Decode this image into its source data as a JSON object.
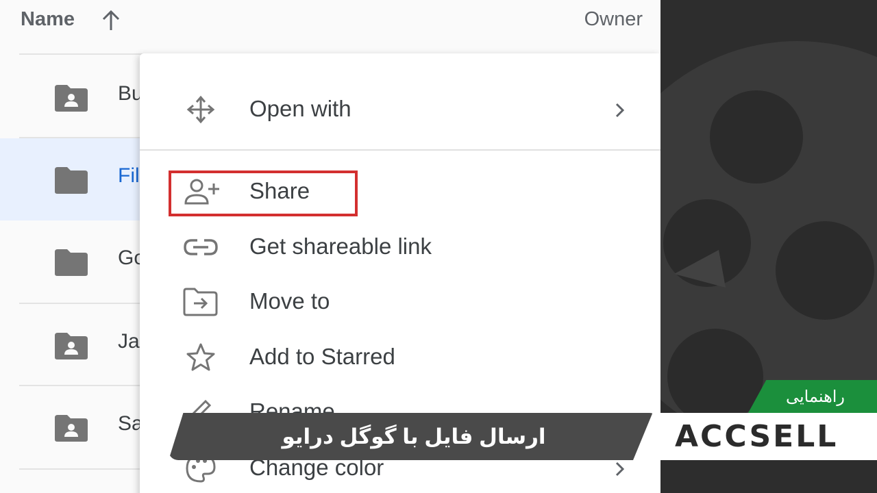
{
  "list": {
    "header": {
      "name_label": "Name",
      "owner_label": "Owner",
      "sort_icon": "arrow-up-icon"
    },
    "rows": [
      {
        "name": "Bu",
        "icon": "shared-folder-icon",
        "selected": false
      },
      {
        "name": "Fil",
        "icon": "folder-icon",
        "selected": true
      },
      {
        "name": "Go",
        "icon": "folder-icon",
        "selected": false
      },
      {
        "name": "Ja",
        "icon": "shared-folder-icon",
        "selected": false
      },
      {
        "name": "Sa",
        "icon": "shared-folder-icon",
        "selected": false
      }
    ]
  },
  "menu": {
    "items": [
      {
        "label": "Open with",
        "icon": "open-with-icon",
        "submenu": true
      },
      {
        "label": "Share",
        "icon": "person-add-icon",
        "submenu": false,
        "highlighted": true
      },
      {
        "label": "Get shareable link",
        "icon": "link-icon",
        "submenu": false
      },
      {
        "label": "Move to",
        "icon": "move-to-folder-icon",
        "submenu": false
      },
      {
        "label": "Add to Starred",
        "icon": "star-icon",
        "submenu": false
      },
      {
        "label": "Rename",
        "icon": "pencil-icon",
        "submenu": false
      },
      {
        "label": "Change color",
        "icon": "palette-icon",
        "submenu": true
      }
    ],
    "highlight_color": "#d32f2f"
  },
  "banner": {
    "title": "ارسال فایل با گوگل درایو",
    "tag": "راهنمایی",
    "logo_text": "ACCSELL",
    "tag_color": "#1b8f3c"
  },
  "colors": {
    "selected_row": "#e8f0fe",
    "selected_text": "#1967d2",
    "icon_gray": "#757575",
    "dark_panel": "#2d2d2d"
  }
}
